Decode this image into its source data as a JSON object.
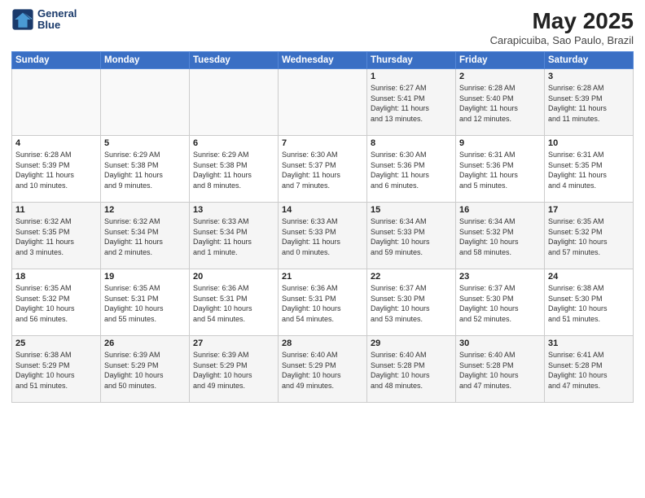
{
  "header": {
    "logo_line1": "General",
    "logo_line2": "Blue",
    "title": "May 2025",
    "subtitle": "Carapicuiba, Sao Paulo, Brazil"
  },
  "weekdays": [
    "Sunday",
    "Monday",
    "Tuesday",
    "Wednesday",
    "Thursday",
    "Friday",
    "Saturday"
  ],
  "weeks": [
    [
      {
        "day": "",
        "info": ""
      },
      {
        "day": "",
        "info": ""
      },
      {
        "day": "",
        "info": ""
      },
      {
        "day": "",
        "info": ""
      },
      {
        "day": "1",
        "info": "Sunrise: 6:27 AM\nSunset: 5:41 PM\nDaylight: 11 hours\nand 13 minutes."
      },
      {
        "day": "2",
        "info": "Sunrise: 6:28 AM\nSunset: 5:40 PM\nDaylight: 11 hours\nand 12 minutes."
      },
      {
        "day": "3",
        "info": "Sunrise: 6:28 AM\nSunset: 5:39 PM\nDaylight: 11 hours\nand 11 minutes."
      }
    ],
    [
      {
        "day": "4",
        "info": "Sunrise: 6:28 AM\nSunset: 5:39 PM\nDaylight: 11 hours\nand 10 minutes."
      },
      {
        "day": "5",
        "info": "Sunrise: 6:29 AM\nSunset: 5:38 PM\nDaylight: 11 hours\nand 9 minutes."
      },
      {
        "day": "6",
        "info": "Sunrise: 6:29 AM\nSunset: 5:38 PM\nDaylight: 11 hours\nand 8 minutes."
      },
      {
        "day": "7",
        "info": "Sunrise: 6:30 AM\nSunset: 5:37 PM\nDaylight: 11 hours\nand 7 minutes."
      },
      {
        "day": "8",
        "info": "Sunrise: 6:30 AM\nSunset: 5:36 PM\nDaylight: 11 hours\nand 6 minutes."
      },
      {
        "day": "9",
        "info": "Sunrise: 6:31 AM\nSunset: 5:36 PM\nDaylight: 11 hours\nand 5 minutes."
      },
      {
        "day": "10",
        "info": "Sunrise: 6:31 AM\nSunset: 5:35 PM\nDaylight: 11 hours\nand 4 minutes."
      }
    ],
    [
      {
        "day": "11",
        "info": "Sunrise: 6:32 AM\nSunset: 5:35 PM\nDaylight: 11 hours\nand 3 minutes."
      },
      {
        "day": "12",
        "info": "Sunrise: 6:32 AM\nSunset: 5:34 PM\nDaylight: 11 hours\nand 2 minutes."
      },
      {
        "day": "13",
        "info": "Sunrise: 6:33 AM\nSunset: 5:34 PM\nDaylight: 11 hours\nand 1 minute."
      },
      {
        "day": "14",
        "info": "Sunrise: 6:33 AM\nSunset: 5:33 PM\nDaylight: 11 hours\nand 0 minutes."
      },
      {
        "day": "15",
        "info": "Sunrise: 6:34 AM\nSunset: 5:33 PM\nDaylight: 10 hours\nand 59 minutes."
      },
      {
        "day": "16",
        "info": "Sunrise: 6:34 AM\nSunset: 5:32 PM\nDaylight: 10 hours\nand 58 minutes."
      },
      {
        "day": "17",
        "info": "Sunrise: 6:35 AM\nSunset: 5:32 PM\nDaylight: 10 hours\nand 57 minutes."
      }
    ],
    [
      {
        "day": "18",
        "info": "Sunrise: 6:35 AM\nSunset: 5:32 PM\nDaylight: 10 hours\nand 56 minutes."
      },
      {
        "day": "19",
        "info": "Sunrise: 6:35 AM\nSunset: 5:31 PM\nDaylight: 10 hours\nand 55 minutes."
      },
      {
        "day": "20",
        "info": "Sunrise: 6:36 AM\nSunset: 5:31 PM\nDaylight: 10 hours\nand 54 minutes."
      },
      {
        "day": "21",
        "info": "Sunrise: 6:36 AM\nSunset: 5:31 PM\nDaylight: 10 hours\nand 54 minutes."
      },
      {
        "day": "22",
        "info": "Sunrise: 6:37 AM\nSunset: 5:30 PM\nDaylight: 10 hours\nand 53 minutes."
      },
      {
        "day": "23",
        "info": "Sunrise: 6:37 AM\nSunset: 5:30 PM\nDaylight: 10 hours\nand 52 minutes."
      },
      {
        "day": "24",
        "info": "Sunrise: 6:38 AM\nSunset: 5:30 PM\nDaylight: 10 hours\nand 51 minutes."
      }
    ],
    [
      {
        "day": "25",
        "info": "Sunrise: 6:38 AM\nSunset: 5:29 PM\nDaylight: 10 hours\nand 51 minutes."
      },
      {
        "day": "26",
        "info": "Sunrise: 6:39 AM\nSunset: 5:29 PM\nDaylight: 10 hours\nand 50 minutes."
      },
      {
        "day": "27",
        "info": "Sunrise: 6:39 AM\nSunset: 5:29 PM\nDaylight: 10 hours\nand 49 minutes."
      },
      {
        "day": "28",
        "info": "Sunrise: 6:40 AM\nSunset: 5:29 PM\nDaylight: 10 hours\nand 49 minutes."
      },
      {
        "day": "29",
        "info": "Sunrise: 6:40 AM\nSunset: 5:28 PM\nDaylight: 10 hours\nand 48 minutes."
      },
      {
        "day": "30",
        "info": "Sunrise: 6:40 AM\nSunset: 5:28 PM\nDaylight: 10 hours\nand 47 minutes."
      },
      {
        "day": "31",
        "info": "Sunrise: 6:41 AM\nSunset: 5:28 PM\nDaylight: 10 hours\nand 47 minutes."
      }
    ]
  ]
}
